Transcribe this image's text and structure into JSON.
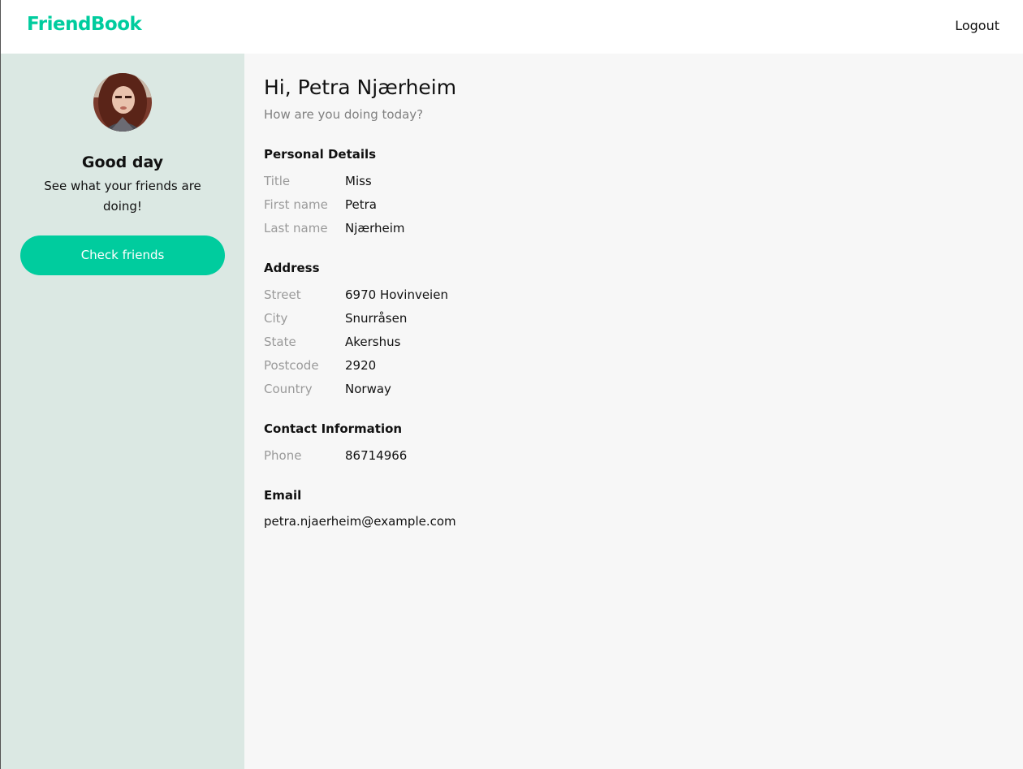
{
  "app": {
    "brand": "FriendBook",
    "logout_label": "Logout",
    "accent_color": "#00cc9e"
  },
  "sidebar": {
    "avatar_alt": "profile-photo",
    "greeting": "Good day",
    "subgreeting": "See what your friends are doing!",
    "cta_label": "Check friends"
  },
  "main": {
    "greeting": "Hi, Petra Njærheim",
    "subtitle": "How are you doing today?",
    "sections": [
      {
        "title": "Personal Details",
        "rows": [
          {
            "label": "Title",
            "value": "Miss"
          },
          {
            "label": "First name",
            "value": "Petra"
          },
          {
            "label": "Last name",
            "value": "Njærheim"
          }
        ]
      },
      {
        "title": "Address",
        "rows": [
          {
            "label": "Street",
            "value": "6970 Hovinveien"
          },
          {
            "label": "City",
            "value": "Snurråsen"
          },
          {
            "label": "State",
            "value": "Akershus"
          },
          {
            "label": "Postcode",
            "value": "2920"
          },
          {
            "label": "Country",
            "value": "Norway"
          }
        ]
      },
      {
        "title": "Contact Information",
        "rows": [
          {
            "label": "Phone",
            "value": "86714966"
          }
        ]
      }
    ],
    "email_title": "Email",
    "email_value": "petra.njaerheim@example.com"
  }
}
